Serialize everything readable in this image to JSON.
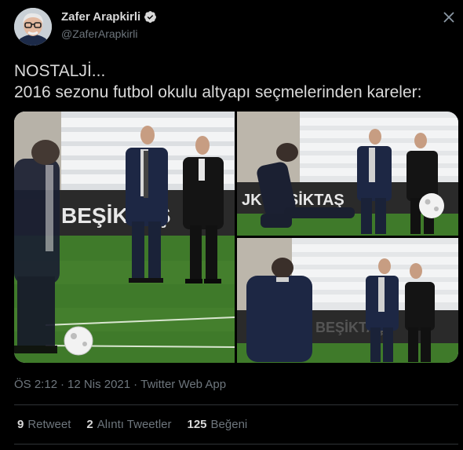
{
  "author": {
    "display_name": "Zafer Arapkirli",
    "handle": "@ZaferArapkirli",
    "verified": true
  },
  "tweet": {
    "line1": "NOSTALJİ...",
    "line2": "2016 sezonu futbol okulu altyapı seçmelerinden kareler:"
  },
  "media": {
    "photo1": {
      "banner": "BEŞİKTAŞ"
    },
    "photo2": {
      "banner": "JK BEŞİKTAŞ"
    },
    "photo3": {
      "banner": "BEŞİKTAŞ"
    }
  },
  "meta": {
    "time": "ÖS 2:12",
    "separator1": "·",
    "date": "12 Nis 2021",
    "separator2": "·",
    "source": "Twitter Web App"
  },
  "stats": {
    "retweets": {
      "count": "9",
      "label": "Retweet"
    },
    "quotes": {
      "count": "2",
      "label": "Alıntı Tweetler"
    },
    "likes": {
      "count": "125",
      "label": "Beğeni"
    }
  },
  "colors": {
    "background": "#000000",
    "primary_text": "#d9d9d9",
    "secondary_text": "#6e767d",
    "divider": "#2f3336",
    "verified": "#d9d9d9",
    "pitch": "#3f7a2a"
  },
  "icons": {
    "verified": "verified-badge-icon",
    "more": "more-options-icon"
  }
}
